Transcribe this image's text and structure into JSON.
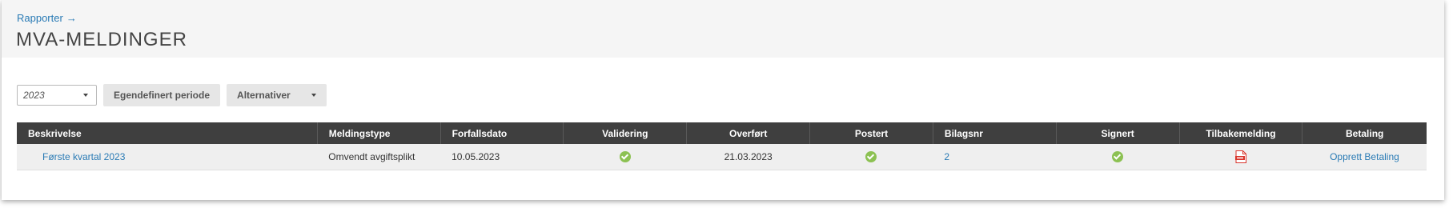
{
  "header": {
    "breadcrumb": "Rapporter",
    "breadcrumb_arrow": "→",
    "title": "MVA-MELDINGER"
  },
  "toolbar": {
    "year": "2023",
    "custom_period_label": "Egendefinert periode",
    "alternatives_label": "Alternativer"
  },
  "table": {
    "columns": [
      "Beskrivelse",
      "Meldingstype",
      "Forfallsdato",
      "Validering",
      "Overført",
      "Postert",
      "Bilagsnr",
      "Signert",
      "Tilbakemelding",
      "Betaling"
    ],
    "rows": [
      {
        "beskrivelse": "Første kvartal 2023",
        "meldingstype": "Omvendt avgiftsplikt",
        "forfallsdato": "10.05.2023",
        "validering": "check-circle-icon",
        "overfort": "21.03.2023",
        "postert": "check-circle-icon",
        "bilagsnr": "2",
        "signert": "check-circle-icon",
        "tilbakemelding": "pdf-icon",
        "betaling": "Opprett Betaling"
      }
    ]
  },
  "colors": {
    "link": "#2a7bb5",
    "header_bg": "#3f3f3f",
    "check": "#8cc152",
    "pdf": "#d9342b"
  }
}
